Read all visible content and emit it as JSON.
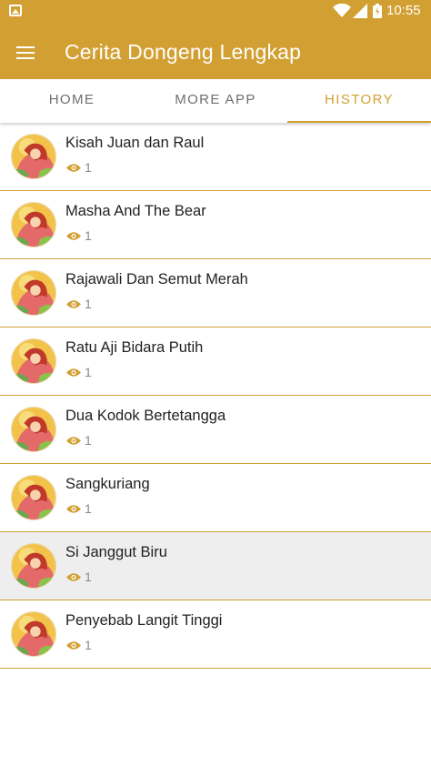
{
  "status_bar": {
    "time": "10:55",
    "icons": [
      "image-notification-icon",
      "wifi-icon",
      "signal-icon",
      "battery-icon"
    ]
  },
  "app_bar": {
    "title": "Cerita Dongeng Lengkap",
    "menu_icon": "hamburger-menu-icon"
  },
  "tabs": [
    {
      "label": "HOME",
      "active": false
    },
    {
      "label": "MORE APP",
      "active": false
    },
    {
      "label": "HISTORY",
      "active": true
    }
  ],
  "history": [
    {
      "title": "Kisah Juan dan Raul",
      "views": "1"
    },
    {
      "title": "Masha And The Bear",
      "views": "1"
    },
    {
      "title": "Rajawali Dan Semut Merah",
      "views": "1"
    },
    {
      "title": "Ratu Aji Bidara Putih",
      "views": "1"
    },
    {
      "title": "Dua Kodok Bertetangga",
      "views": "1"
    },
    {
      "title": "Sangkuriang",
      "views": "1"
    },
    {
      "title": "Si Janggut Biru",
      "views": "1"
    },
    {
      "title": "Penyebab Langit Tinggi",
      "views": "1"
    }
  ],
  "colors": {
    "accent": "#d2a032",
    "tab_inactive": "#6e6e6e",
    "row_highlight": "#eeeeee"
  }
}
